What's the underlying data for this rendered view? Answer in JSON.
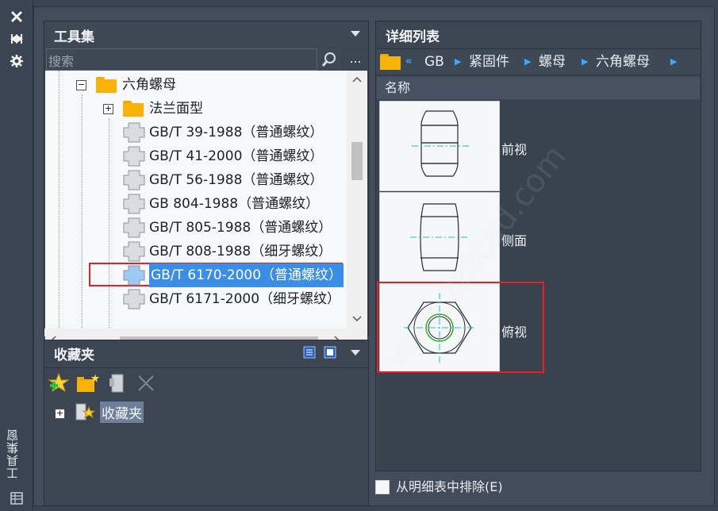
{
  "strip": {
    "title": "工具集窗",
    "icons": [
      "close-icon",
      "pin-icon",
      "gear-icon"
    ]
  },
  "tool_palette": {
    "title": "工具集",
    "search_placeholder": "搜索",
    "more_label": "...",
    "tree": [
      {
        "label": "六角螺母",
        "type": "folder",
        "expanded": true
      },
      {
        "label": "法兰面型",
        "type": "folder",
        "expanded": false
      },
      {
        "label": "GB/T 39-1988（普通螺纹）",
        "type": "tool"
      },
      {
        "label": "GB/T 41-2000（普通螺纹）",
        "type": "tool"
      },
      {
        "label": "GB/T 56-1988（普通螺纹）",
        "type": "tool"
      },
      {
        "label": "GB 804-1988（普通螺纹）",
        "type": "tool"
      },
      {
        "label": "GB/T 805-1988（普通螺纹）",
        "type": "tool"
      },
      {
        "label": "GB/T 808-1988（细牙螺纹）",
        "type": "tool"
      },
      {
        "label": "GB/T 6170-2000（普通螺纹）",
        "type": "tool",
        "selected": true
      },
      {
        "label": "GB/T 6171-2000（细牙螺纹）",
        "type": "tool"
      }
    ],
    "grip": "•••••"
  },
  "favorites": {
    "title": "收藏夹",
    "tree_item": "收藏夹"
  },
  "detail_list": {
    "title": "详细列表",
    "breadcrumb": [
      "GB",
      "紧固件",
      "螺母",
      "六角螺母"
    ],
    "column_header": "名称",
    "items": [
      {
        "label": "前视"
      },
      {
        "label": "侧面"
      },
      {
        "label": "俯视"
      }
    ]
  },
  "exclude_checkbox": {
    "label": "从明细表中排除(E)",
    "checked": false
  },
  "watermark": "www.zzzcad.com",
  "colors": {
    "selection": "#3a8ee6",
    "highlight": "#e52027",
    "folder": "#f9b208"
  }
}
